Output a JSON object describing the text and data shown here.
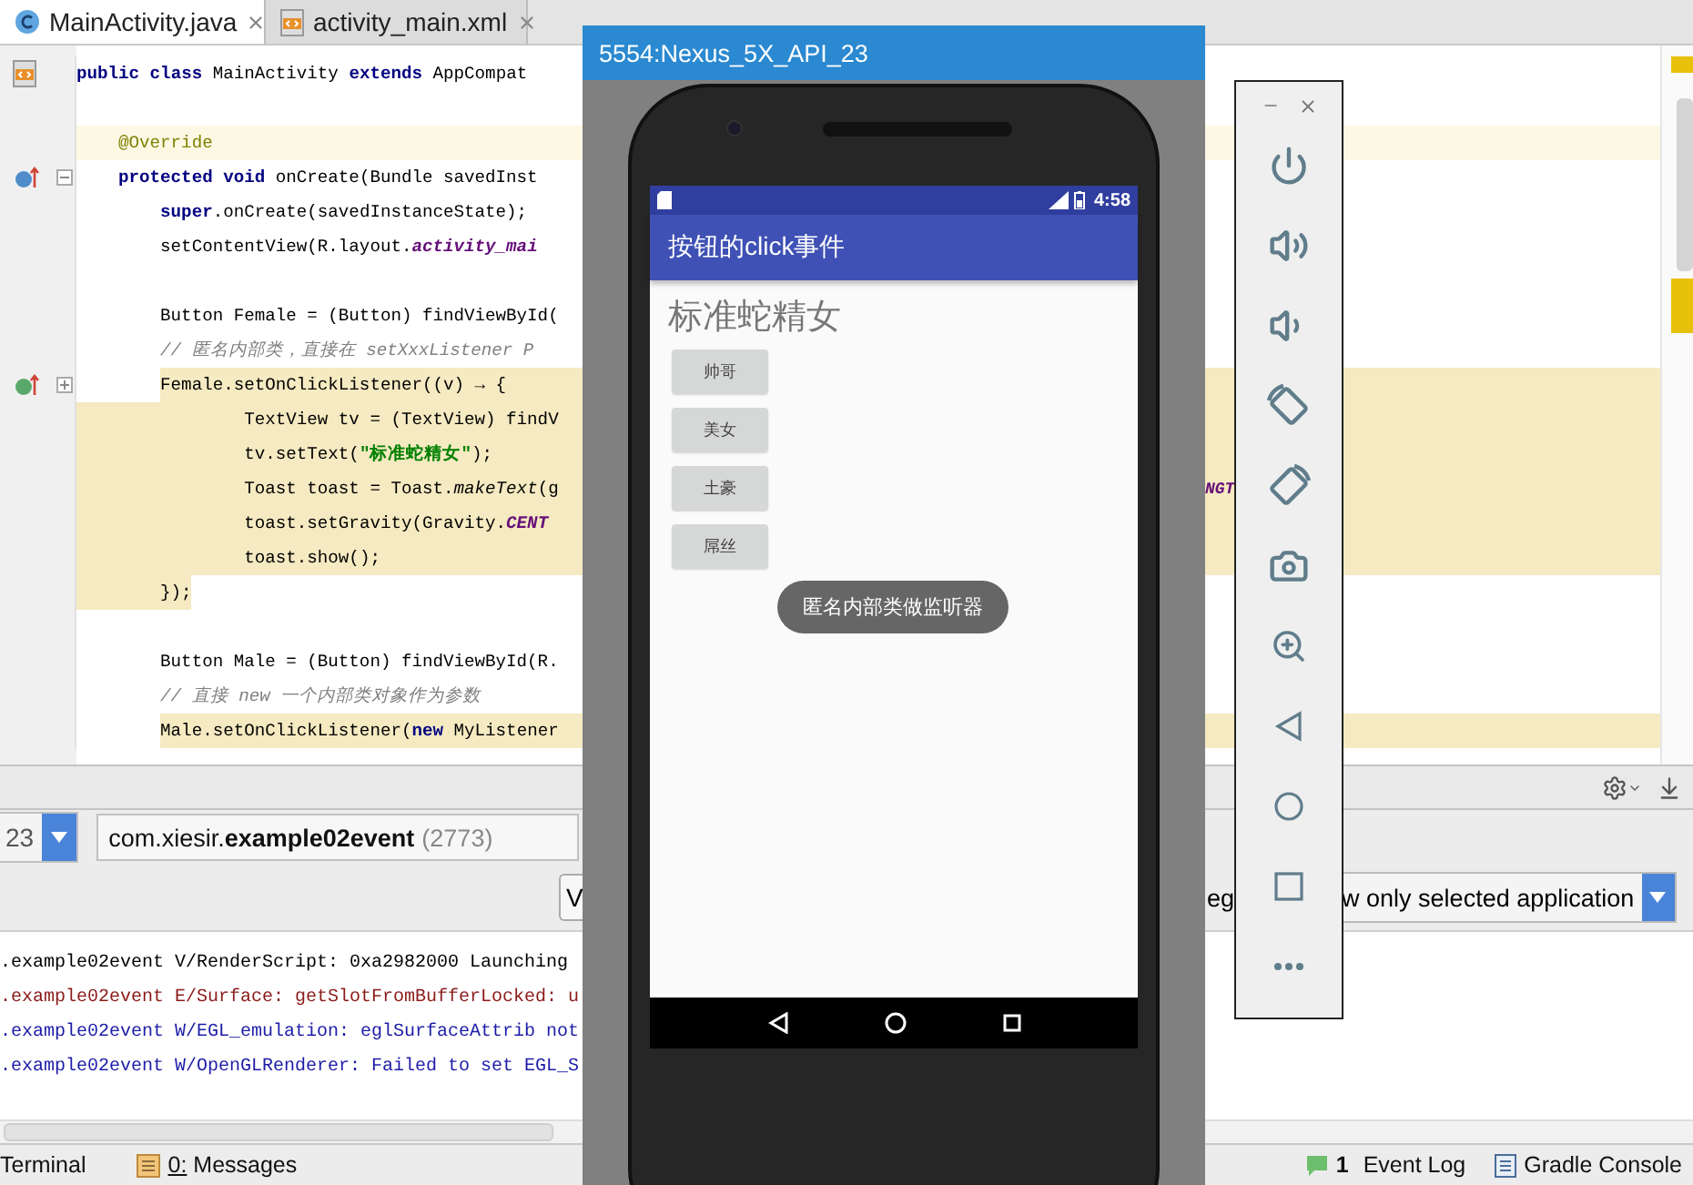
{
  "editor_tabs": [
    {
      "label": "MainActivity.java",
      "kind": "class",
      "selected": true
    },
    {
      "label": "activity_main.xml",
      "kind": "xml",
      "selected": false
    }
  ],
  "code_lines": [
    {
      "kind": "code",
      "current": false,
      "highlighted": false,
      "marker": {
        "kind": "layout"
      },
      "segments": [
        {
          "text": "public class",
          "kind": "keyword"
        },
        {
          "text": " MainActivity ",
          "kind": "plain"
        },
        {
          "text": "extends",
          "kind": "keyword"
        },
        {
          "text": " AppCompat",
          "kind": "plain"
        }
      ]
    },
    {
      "kind": "blank"
    },
    {
      "kind": "code",
      "current": true,
      "highlighted": false,
      "segments": [
        {
          "text": "    @Override",
          "kind": "annotation"
        }
      ]
    },
    {
      "kind": "code",
      "current": false,
      "highlighted": false,
      "marker": {
        "kind": "override"
      },
      "fold": {
        "expanded": true
      },
      "segments": [
        {
          "text": "    protected void",
          "kind": "keyword"
        },
        {
          "text": " onCreate(Bundle savedInst",
          "kind": "plain"
        }
      ]
    },
    {
      "kind": "code",
      "current": false,
      "highlighted": false,
      "segments": [
        {
          "text": "        super",
          "kind": "keyword"
        },
        {
          "text": ".onCreate(savedInstanceState);",
          "kind": "plain"
        }
      ]
    },
    {
      "kind": "code",
      "current": false,
      "highlighted": false,
      "segments": [
        {
          "text": "        setContentView(R.layout.",
          "kind": "plain"
        },
        {
          "text": "activity_mai",
          "kind": "field"
        }
      ]
    },
    {
      "kind": "blank"
    },
    {
      "kind": "code",
      "current": false,
      "highlighted": false,
      "segments": [
        {
          "text": "        Button Female = (Button) findViewById(",
          "kind": "plain"
        }
      ]
    },
    {
      "kind": "code",
      "current": false,
      "highlighted": false,
      "segments": [
        {
          "text": "        // 匿名内部类，直接在 setXxxListener P",
          "kind": "comment"
        }
      ]
    },
    {
      "kind": "code",
      "current": false,
      "highlighted": true,
      "marker": {
        "kind": "implement"
      },
      "fold": {
        "expanded": false
      },
      "segments": [
        {
          "text": "        Female.setOnClickListener((v) → {",
          "kind": "plain"
        }
      ]
    },
    {
      "kind": "code",
      "current": false,
      "highlighted": true,
      "segments": [
        {
          "text": "                TextView tv = (TextView) findV",
          "kind": "plain"
        }
      ]
    },
    {
      "kind": "code",
      "current": false,
      "highlighted": true,
      "segments": [
        {
          "text": "                tv.setText(",
          "kind": "plain"
        },
        {
          "text": "\"标准蛇精女\"",
          "kind": "string"
        },
        {
          "text": ");",
          "kind": "plain"
        }
      ]
    },
    {
      "kind": "code",
      "current": false,
      "highlighted": true,
      "segments": [
        {
          "text": "                Toast toast = Toast.",
          "kind": "plain"
        },
        {
          "text": "makeText",
          "kind": "static"
        },
        {
          "text": "(g",
          "kind": "plain"
        }
      ],
      "tail": {
        "text": "NGT",
        "kind": "field"
      }
    },
    {
      "kind": "code",
      "current": false,
      "highlighted": true,
      "segments": [
        {
          "text": "                toast.setGravity(Gravity.",
          "kind": "plain"
        },
        {
          "text": "CENT",
          "kind": "field"
        }
      ]
    },
    {
      "kind": "code",
      "current": false,
      "highlighted": true,
      "segments": [
        {
          "text": "                toast.show();",
          "kind": "plain"
        }
      ]
    },
    {
      "kind": "code",
      "current": false,
      "highlighted": true,
      "segments": [
        {
          "text": "        });",
          "kind": "plain"
        }
      ]
    },
    {
      "kind": "blank"
    },
    {
      "kind": "code",
      "current": false,
      "highlighted": false,
      "segments": [
        {
          "text": "        Button Male = (Button) findViewById(R.",
          "kind": "plain"
        }
      ]
    },
    {
      "kind": "code",
      "current": false,
      "highlighted": false,
      "segments": [
        {
          "text": "        // 直接 new 一个内部类对象作为参数",
          "kind": "comment"
        }
      ]
    },
    {
      "kind": "code",
      "current": false,
      "highlighted": true,
      "segments": [
        {
          "text": "        Male.setOnClickListener(",
          "kind": "plain"
        },
        {
          "text": "new",
          "kind": "keyword"
        },
        {
          "text": " MyListener",
          "kind": "plain"
        }
      ]
    }
  ],
  "logcat": {
    "device": "23",
    "process": "com.xiesir.**example02event**",
    "pid": "(2773)",
    "level_dropdown": "V",
    "regex_label": "eg",
    "scope_dropdown": "w only selected application",
    "lines": [
      {
        "text": ".example02event V/RenderScript: 0xa2982000 Launching",
        "kind": "verbose"
      },
      {
        "text": ".example02event E/Surface: getSlotFromBufferLocked: u",
        "kind": "error"
      },
      {
        "text": ".example02event W/EGL_emulation: eglSurfaceAttrib not",
        "kind": "warn"
      },
      {
        "text": ".example02event W/OpenGLRenderer: Failed to set EGL_S",
        "kind": "warn"
      }
    ]
  },
  "status_bar": {
    "terminal": "Terminal",
    "messages": "0: Messages",
    "event_count": "1",
    "event_log": "Event Log",
    "gradle_console": "Gradle Console"
  },
  "emulator": {
    "title": "5554:Nexus_5X_API_23",
    "time": "4:58",
    "app_title": "按钮的click事件",
    "text_view": "标准蛇精女",
    "buttons": [
      "帅哥",
      "美女",
      "土豪",
      "屌丝"
    ],
    "toast": "匿名内部类做监听器"
  }
}
